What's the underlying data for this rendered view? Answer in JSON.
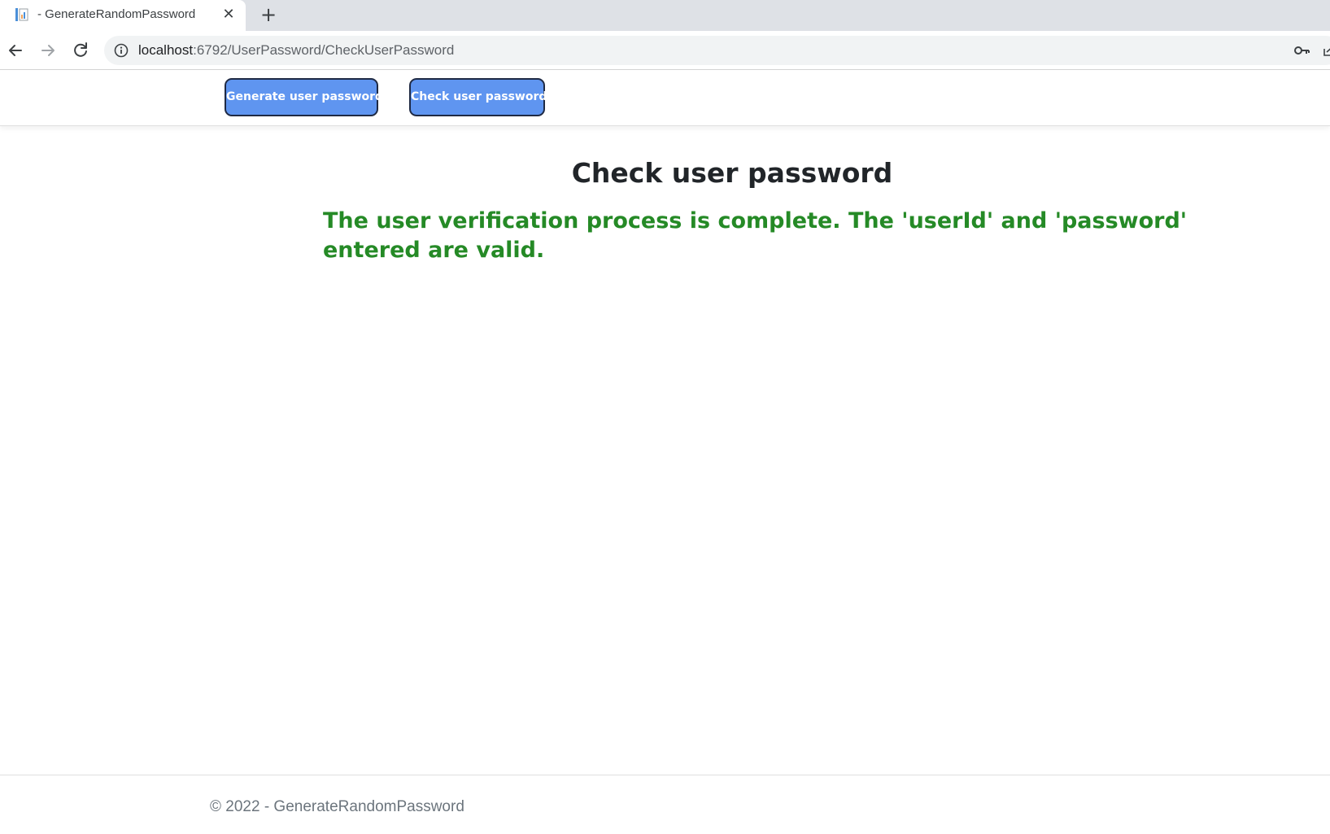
{
  "browser": {
    "tab_title": "- GenerateRandomPassword",
    "url_host": "localhost",
    "url_rest": ":6792/UserPassword/CheckUserPassword"
  },
  "icons": {
    "favicon": "page-favicon-icon",
    "tab_close": "close-icon",
    "new_tab": "plus-icon",
    "back": "arrow-left-icon",
    "forward": "arrow-right-icon",
    "reload": "reload-icon",
    "site_info": "info-icon",
    "password_key": "key-icon",
    "share": "share-icon"
  },
  "nav": {
    "generate_label": "Generate user password",
    "check_label": "Check user password"
  },
  "main": {
    "title": "Check user password",
    "message": "The user verification process is complete. The 'userId' and 'password' entered are valid."
  },
  "footer": {
    "text": "© 2022 - GenerateRandomPassword"
  },
  "colors": {
    "button_bg": "#5f95f0",
    "button_border": "#1f2a44",
    "success_text": "#258a26",
    "title_text": "#212529",
    "footer_text": "#6c757d"
  }
}
